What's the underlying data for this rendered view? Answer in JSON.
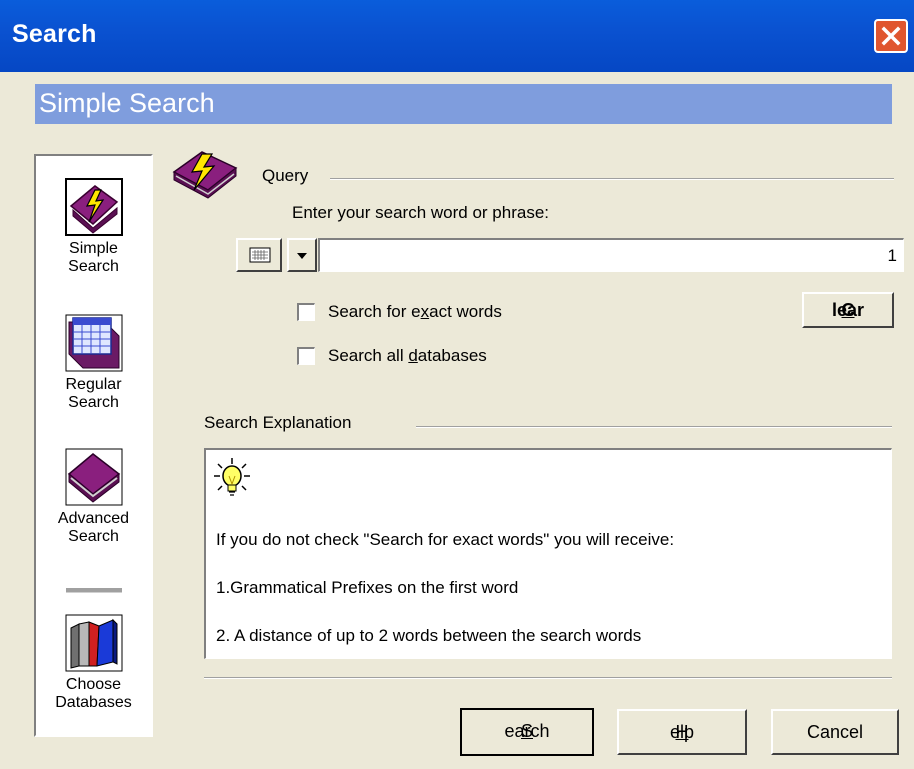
{
  "window": {
    "title": "Search",
    "close_label": "X"
  },
  "header": {
    "title": "Simple Search"
  },
  "sidebar": {
    "items": [
      {
        "label_line1": "Simple",
        "label_line2": "Search",
        "icon": "lightning-book-icon"
      },
      {
        "label_line1": "Regular",
        "label_line2": "Search",
        "icon": "table-book-icon"
      },
      {
        "label_line1": "Advanced",
        "label_line2": "Search",
        "icon": "purple-book-icon"
      },
      {
        "label_line1": "Choose",
        "label_line2": "Databases",
        "icon": "books-icon"
      }
    ]
  },
  "query": {
    "section_label": "Query",
    "prompt": "Enter your search word or phrase:",
    "input_value": "",
    "counter": "1",
    "keyboard_icon": "keyboard-icon",
    "dropdown_icon": "dropdown-arrow-icon"
  },
  "options": {
    "exact_words": {
      "pre": "Search for e",
      "accel": "x",
      "post": "act words",
      "checked": false
    },
    "all_databases": {
      "pre": "Search all ",
      "accel": "d",
      "post": "atabases",
      "checked": false
    },
    "clear": {
      "accel": "C",
      "post": "lear"
    }
  },
  "explanation": {
    "section_label": "Search Explanation",
    "icon": "lightbulb-icon",
    "lines": [
      "If you do not check \"Search for exact words\" you will receive:",
      "1.Grammatical Prefixes on the first word",
      "2. A distance of up to 2 words between the search words"
    ]
  },
  "buttons": {
    "search": {
      "accel": "S",
      "post": "earch"
    },
    "help": {
      "accel": "H",
      "post": "elp"
    },
    "cancel": {
      "label": "Cancel"
    }
  },
  "colors": {
    "titlebar": "#0a52d1",
    "header": "#7f9ddd",
    "dialog_bg": "#ece9d8",
    "close": "#e0562f"
  }
}
